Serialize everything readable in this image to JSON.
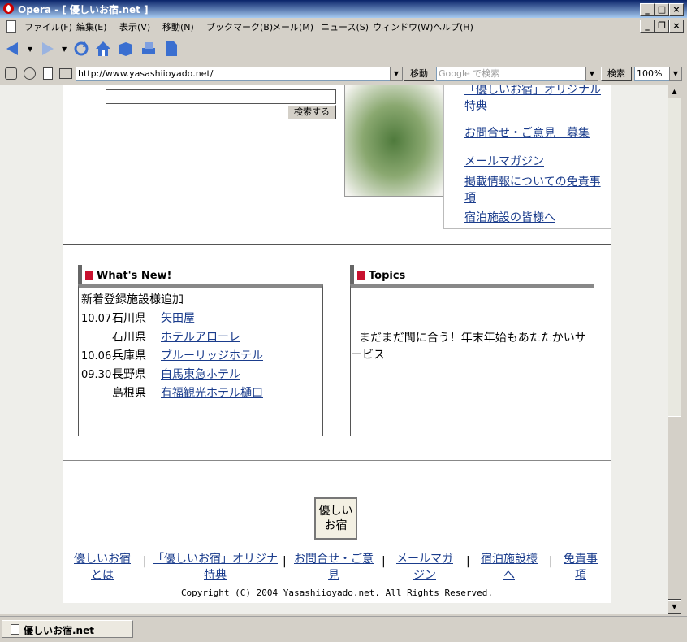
{
  "window": {
    "title": "Opera - [ 優しいお宿.net ]"
  },
  "menu": [
    "ファイル(F)",
    "編集(E)",
    "表示(V)",
    "移動(N)",
    "ブックマーク(B)",
    "メール(M)",
    "ニュース(S)",
    "ウィンドウ(W)",
    "ヘルプ(H)"
  ],
  "address": {
    "url": "http://www.yasashiioyado.net/",
    "go_label": "移動",
    "search_placeholder": "Google で検索",
    "search_label": "検索",
    "zoom": "100%"
  },
  "page": {
    "search_button": "検索する",
    "side_links": [
      "「優しいお宿」オリジナル特典",
      "お問合せ・ご意見　募集",
      "メールマガジン",
      "掲載情報についての免責事項",
      "宿泊施設の皆様へ"
    ],
    "whats_new": {
      "title": "What's New!",
      "heading": "新着登録施設様追加",
      "rows": [
        {
          "date": "10.07",
          "pref": "石川県",
          "name": "矢田屋"
        },
        {
          "date": "",
          "pref": "石川県",
          "name": "ホテルアローレ"
        },
        {
          "date": "10.06",
          "pref": "兵庫県",
          "name": "ブルーリッジホテル"
        },
        {
          "date": "09.30",
          "pref": "長野県",
          "name": "白馬東急ホテル"
        },
        {
          "date": "",
          "pref": "島根県",
          "name": "有福観光ホテル樋口"
        }
      ]
    },
    "topics": {
      "title": "Topics",
      "text": "まだまだ間に合う！年末年始もあたたかいサービス"
    },
    "footer_logo_text": "優しいお宿",
    "footer_links": [
      "優しいお宿とは",
      "「優しいお宿」オリジナ特典",
      "お問合せ・ご意見",
      "メールマガジン",
      "宿泊施設様へ",
      "免責事項"
    ],
    "copyright": "Copyright (C) 2004 Yasashiioyado.net. All Rights Reserved."
  },
  "status": {
    "tab_label": "優しいお宿.net"
  }
}
